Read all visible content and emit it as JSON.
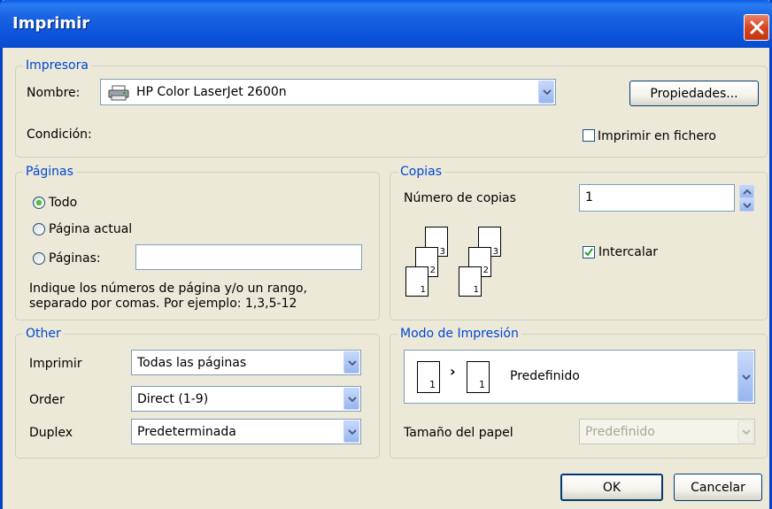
{
  "window": {
    "title": "Imprimir"
  },
  "printer": {
    "group_label": "Impresora",
    "name_label": "Nombre:",
    "name_value": "HP Color LaserJet 2600n",
    "properties_button": "Propiedades...",
    "status_label": "Condición:",
    "print_to_file_label": "Imprimir en fichero",
    "print_to_file_checked": false
  },
  "pages": {
    "group_label": "Páginas",
    "all_label": "Todo",
    "current_label": "Página actual",
    "range_label": "Páginas:",
    "range_value": "",
    "selected": "all",
    "hint_line1": "Indique los números de página y/o un rango,",
    "hint_line2": "separado por comas. Por ejemplo: 1,3,5-12"
  },
  "copies": {
    "group_label": "Copias",
    "count_label": "Número de copias",
    "count_value": "1",
    "collate_label": "Intercalar",
    "collate_checked": true,
    "page_numbers": [
      "3",
      "2",
      "1"
    ]
  },
  "other": {
    "group_label": "Other",
    "print_label": "Imprimir",
    "print_value": "Todas las páginas",
    "order_label": "Order",
    "order_value": "Direct (1-9)",
    "duplex_label": "Duplex",
    "duplex_value": "Predeterminada"
  },
  "print_mode": {
    "group_label": "Modo de Impresión",
    "mode_value": "Predefinido",
    "page_number": "1",
    "arrow": "›",
    "paper_size_label": "Tamaño del papel",
    "paper_size_value": "Predefinido"
  },
  "buttons": {
    "ok": "OK",
    "cancel": "Cancelar"
  },
  "colors": {
    "title_bar": "#0a4cd0",
    "legend_text": "#0046d5",
    "dialog_bg": "#ece9d8"
  }
}
